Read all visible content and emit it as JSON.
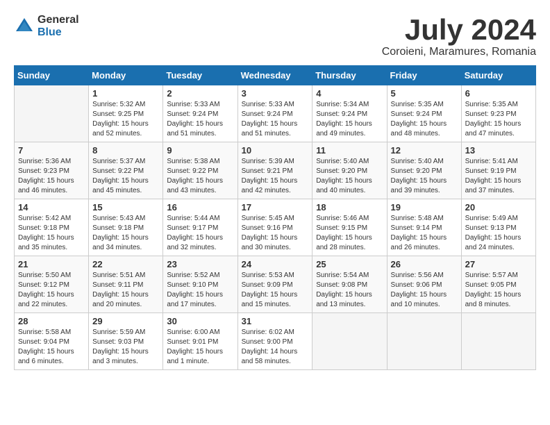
{
  "logo": {
    "general": "General",
    "blue": "Blue"
  },
  "title": "July 2024",
  "subtitle": "Coroieni, Maramures, Romania",
  "days_of_week": [
    "Sunday",
    "Monday",
    "Tuesday",
    "Wednesday",
    "Thursday",
    "Friday",
    "Saturday"
  ],
  "weeks": [
    [
      {
        "day": "",
        "sunrise": "",
        "sunset": "",
        "daylight": "",
        "empty": true
      },
      {
        "day": "1",
        "sunrise": "Sunrise: 5:32 AM",
        "sunset": "Sunset: 9:25 PM",
        "daylight": "Daylight: 15 hours and 52 minutes.",
        "empty": false
      },
      {
        "day": "2",
        "sunrise": "Sunrise: 5:33 AM",
        "sunset": "Sunset: 9:24 PM",
        "daylight": "Daylight: 15 hours and 51 minutes.",
        "empty": false
      },
      {
        "day": "3",
        "sunrise": "Sunrise: 5:33 AM",
        "sunset": "Sunset: 9:24 PM",
        "daylight": "Daylight: 15 hours and 51 minutes.",
        "empty": false
      },
      {
        "day": "4",
        "sunrise": "Sunrise: 5:34 AM",
        "sunset": "Sunset: 9:24 PM",
        "daylight": "Daylight: 15 hours and 49 minutes.",
        "empty": false
      },
      {
        "day": "5",
        "sunrise": "Sunrise: 5:35 AM",
        "sunset": "Sunset: 9:24 PM",
        "daylight": "Daylight: 15 hours and 48 minutes.",
        "empty": false
      },
      {
        "day": "6",
        "sunrise": "Sunrise: 5:35 AM",
        "sunset": "Sunset: 9:23 PM",
        "daylight": "Daylight: 15 hours and 47 minutes.",
        "empty": false
      }
    ],
    [
      {
        "day": "7",
        "sunrise": "Sunrise: 5:36 AM",
        "sunset": "Sunset: 9:23 PM",
        "daylight": "Daylight: 15 hours and 46 minutes.",
        "empty": false
      },
      {
        "day": "8",
        "sunrise": "Sunrise: 5:37 AM",
        "sunset": "Sunset: 9:22 PM",
        "daylight": "Daylight: 15 hours and 45 minutes.",
        "empty": false
      },
      {
        "day": "9",
        "sunrise": "Sunrise: 5:38 AM",
        "sunset": "Sunset: 9:22 PM",
        "daylight": "Daylight: 15 hours and 43 minutes.",
        "empty": false
      },
      {
        "day": "10",
        "sunrise": "Sunrise: 5:39 AM",
        "sunset": "Sunset: 9:21 PM",
        "daylight": "Daylight: 15 hours and 42 minutes.",
        "empty": false
      },
      {
        "day": "11",
        "sunrise": "Sunrise: 5:40 AM",
        "sunset": "Sunset: 9:20 PM",
        "daylight": "Daylight: 15 hours and 40 minutes.",
        "empty": false
      },
      {
        "day": "12",
        "sunrise": "Sunrise: 5:40 AM",
        "sunset": "Sunset: 9:20 PM",
        "daylight": "Daylight: 15 hours and 39 minutes.",
        "empty": false
      },
      {
        "day": "13",
        "sunrise": "Sunrise: 5:41 AM",
        "sunset": "Sunset: 9:19 PM",
        "daylight": "Daylight: 15 hours and 37 minutes.",
        "empty": false
      }
    ],
    [
      {
        "day": "14",
        "sunrise": "Sunrise: 5:42 AM",
        "sunset": "Sunset: 9:18 PM",
        "daylight": "Daylight: 15 hours and 35 minutes.",
        "empty": false
      },
      {
        "day": "15",
        "sunrise": "Sunrise: 5:43 AM",
        "sunset": "Sunset: 9:18 PM",
        "daylight": "Daylight: 15 hours and 34 minutes.",
        "empty": false
      },
      {
        "day": "16",
        "sunrise": "Sunrise: 5:44 AM",
        "sunset": "Sunset: 9:17 PM",
        "daylight": "Daylight: 15 hours and 32 minutes.",
        "empty": false
      },
      {
        "day": "17",
        "sunrise": "Sunrise: 5:45 AM",
        "sunset": "Sunset: 9:16 PM",
        "daylight": "Daylight: 15 hours and 30 minutes.",
        "empty": false
      },
      {
        "day": "18",
        "sunrise": "Sunrise: 5:46 AM",
        "sunset": "Sunset: 9:15 PM",
        "daylight": "Daylight: 15 hours and 28 minutes.",
        "empty": false
      },
      {
        "day": "19",
        "sunrise": "Sunrise: 5:48 AM",
        "sunset": "Sunset: 9:14 PM",
        "daylight": "Daylight: 15 hours and 26 minutes.",
        "empty": false
      },
      {
        "day": "20",
        "sunrise": "Sunrise: 5:49 AM",
        "sunset": "Sunset: 9:13 PM",
        "daylight": "Daylight: 15 hours and 24 minutes.",
        "empty": false
      }
    ],
    [
      {
        "day": "21",
        "sunrise": "Sunrise: 5:50 AM",
        "sunset": "Sunset: 9:12 PM",
        "daylight": "Daylight: 15 hours and 22 minutes.",
        "empty": false
      },
      {
        "day": "22",
        "sunrise": "Sunrise: 5:51 AM",
        "sunset": "Sunset: 9:11 PM",
        "daylight": "Daylight: 15 hours and 20 minutes.",
        "empty": false
      },
      {
        "day": "23",
        "sunrise": "Sunrise: 5:52 AM",
        "sunset": "Sunset: 9:10 PM",
        "daylight": "Daylight: 15 hours and 17 minutes.",
        "empty": false
      },
      {
        "day": "24",
        "sunrise": "Sunrise: 5:53 AM",
        "sunset": "Sunset: 9:09 PM",
        "daylight": "Daylight: 15 hours and 15 minutes.",
        "empty": false
      },
      {
        "day": "25",
        "sunrise": "Sunrise: 5:54 AM",
        "sunset": "Sunset: 9:08 PM",
        "daylight": "Daylight: 15 hours and 13 minutes.",
        "empty": false
      },
      {
        "day": "26",
        "sunrise": "Sunrise: 5:56 AM",
        "sunset": "Sunset: 9:06 PM",
        "daylight": "Daylight: 15 hours and 10 minutes.",
        "empty": false
      },
      {
        "day": "27",
        "sunrise": "Sunrise: 5:57 AM",
        "sunset": "Sunset: 9:05 PM",
        "daylight": "Daylight: 15 hours and 8 minutes.",
        "empty": false
      }
    ],
    [
      {
        "day": "28",
        "sunrise": "Sunrise: 5:58 AM",
        "sunset": "Sunset: 9:04 PM",
        "daylight": "Daylight: 15 hours and 6 minutes.",
        "empty": false
      },
      {
        "day": "29",
        "sunrise": "Sunrise: 5:59 AM",
        "sunset": "Sunset: 9:03 PM",
        "daylight": "Daylight: 15 hours and 3 minutes.",
        "empty": false
      },
      {
        "day": "30",
        "sunrise": "Sunrise: 6:00 AM",
        "sunset": "Sunset: 9:01 PM",
        "daylight": "Daylight: 15 hours and 1 minute.",
        "empty": false
      },
      {
        "day": "31",
        "sunrise": "Sunrise: 6:02 AM",
        "sunset": "Sunset: 9:00 PM",
        "daylight": "Daylight: 14 hours and 58 minutes.",
        "empty": false
      },
      {
        "day": "",
        "sunrise": "",
        "sunset": "",
        "daylight": "",
        "empty": true
      },
      {
        "day": "",
        "sunrise": "",
        "sunset": "",
        "daylight": "",
        "empty": true
      },
      {
        "day": "",
        "sunrise": "",
        "sunset": "",
        "daylight": "",
        "empty": true
      }
    ]
  ]
}
